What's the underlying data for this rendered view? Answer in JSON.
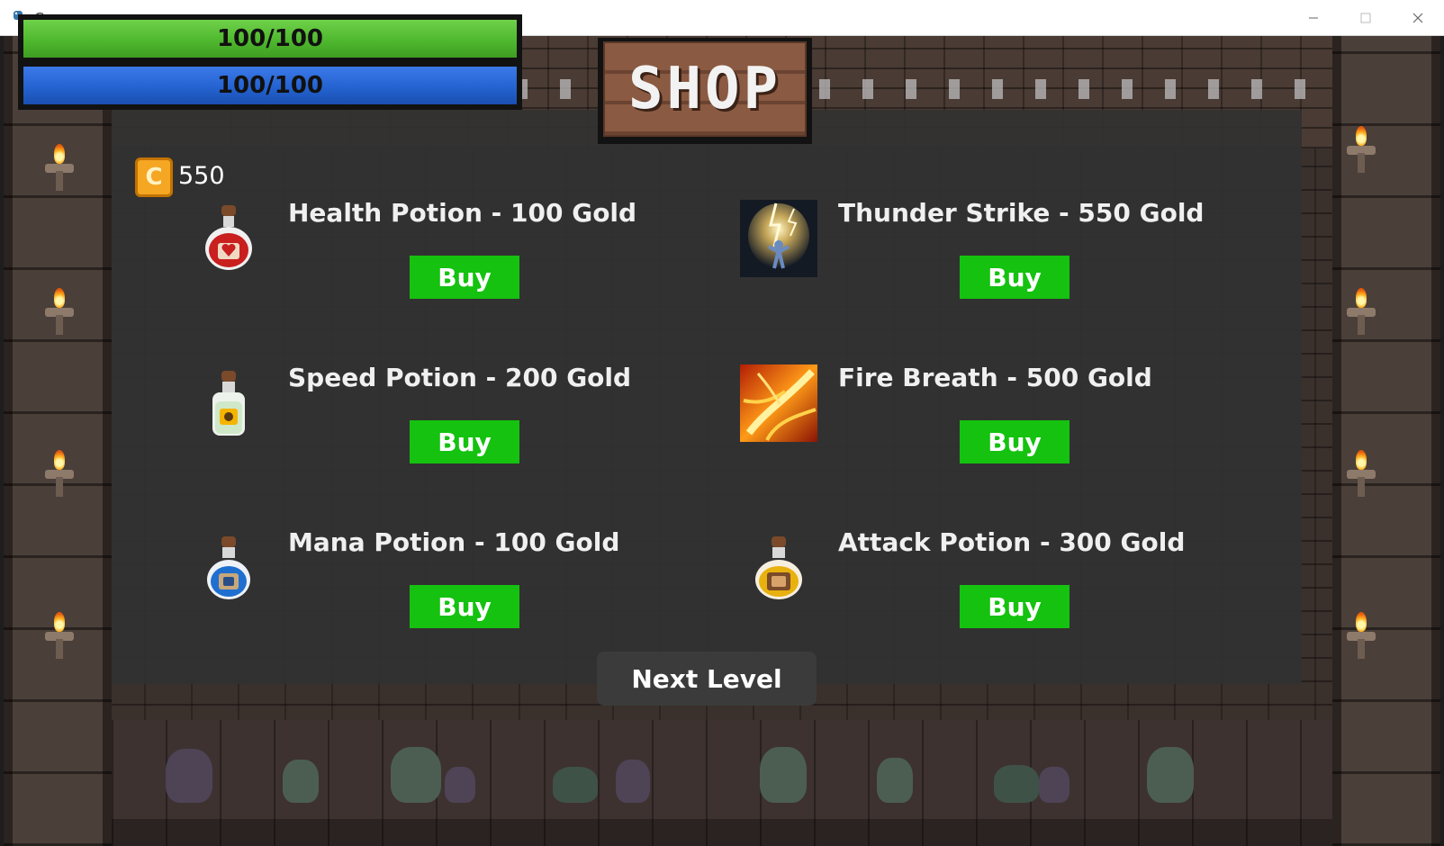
{
  "window": {
    "title": "Game"
  },
  "hud": {
    "health_text": "100/100",
    "mana_text": "100/100"
  },
  "shop": {
    "sign_text": "SHOP",
    "gold": "550",
    "coin_glyph": "C",
    "items": [
      {
        "title": "Health Potion - 100 Gold",
        "buy_label": "Buy",
        "icon": "health-potion-icon"
      },
      {
        "title": "Thunder Strike - 550 Gold",
        "buy_label": "Buy",
        "icon": "thunder-strike-icon"
      },
      {
        "title": "Speed Potion - 200 Gold",
        "buy_label": "Buy",
        "icon": "speed-potion-icon"
      },
      {
        "title": "Fire Breath - 500 Gold",
        "buy_label": "Buy",
        "icon": "fire-breath-icon"
      },
      {
        "title": "Mana Potion - 100 Gold",
        "buy_label": "Buy",
        "icon": "mana-potion-icon"
      },
      {
        "title": "Attack Potion - 300 Gold",
        "buy_label": "Buy",
        "icon": "attack-potion-icon"
      }
    ],
    "next_level_label": "Next Level"
  },
  "colors": {
    "health_bar": "#4fb82e",
    "mana_bar": "#2463d0",
    "buy_button": "#14c20f",
    "panel": "#323232",
    "coin": "#f5a623"
  }
}
